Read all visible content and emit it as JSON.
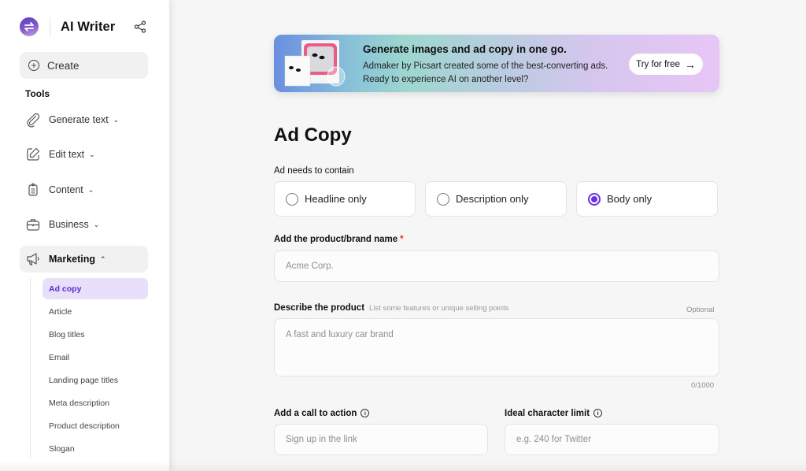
{
  "sidebar": {
    "app_title": "AI Writer",
    "create_label": "Create",
    "tools_heading": "Tools",
    "nav": [
      {
        "label": "Generate text",
        "icon": "paperclip-icon",
        "expanded": false
      },
      {
        "label": "Edit text",
        "icon": "edit-icon",
        "expanded": false
      },
      {
        "label": "Content",
        "icon": "clipboard-icon",
        "expanded": false
      },
      {
        "label": "Business",
        "icon": "briefcase-icon",
        "expanded": false
      },
      {
        "label": "Marketing",
        "icon": "megaphone-icon",
        "expanded": true
      }
    ],
    "marketing_items": [
      {
        "label": "Ad copy",
        "active": true
      },
      {
        "label": "Article"
      },
      {
        "label": "Blog titles"
      },
      {
        "label": "Email"
      },
      {
        "label": "Landing page titles"
      },
      {
        "label": "Meta description"
      },
      {
        "label": "Product description"
      },
      {
        "label": "Slogan"
      }
    ]
  },
  "banner": {
    "title": "Generate images and ad copy in one go.",
    "text": "Admaker by Picsart created some of the best-converting ads. Ready to experience AI on another level?",
    "cta": "Try for free",
    "cta_icon": "arrow-right-icon"
  },
  "form": {
    "title": "Ad Copy",
    "contain_label": "Ad needs to contain",
    "options": [
      {
        "label": "Headline only",
        "selected": false
      },
      {
        "label": "Description only",
        "selected": false
      },
      {
        "label": "Body only",
        "selected": true
      }
    ],
    "brand": {
      "label": "Add the product/brand name",
      "required_mark": "*",
      "placeholder": "Acme Corp."
    },
    "describe": {
      "label": "Describe the product",
      "hint": "List some features or unique selling points",
      "optional": "Optional",
      "placeholder": "A fast and luxury car brand",
      "counter": "0/1000"
    },
    "cta": {
      "label": "Add a call to action",
      "placeholder": "Sign up in the link"
    },
    "char_limit": {
      "label": "Ideal character limit",
      "placeholder": "e.g. 240 for Twitter"
    }
  },
  "colors": {
    "accent": "#6b2fe6",
    "active_bg": "#e8e0fa",
    "required": "#e0332b"
  }
}
